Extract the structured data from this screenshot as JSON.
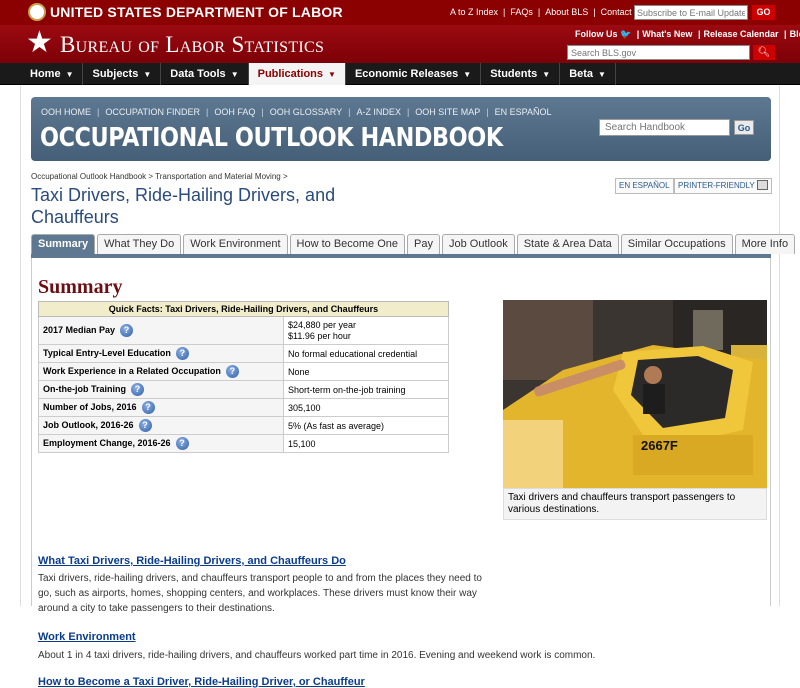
{
  "header": {
    "dol_title": "UNITED STATES DEPARTMENT OF LABOR",
    "top_links": [
      "A to Z Index",
      "FAQs",
      "About BLS",
      "Contact Us"
    ],
    "email_placeholder": "Subscribe to E-mail Updates",
    "go_label": "GO",
    "bls_title": "Bureau of Labor Statistics",
    "follow_links": [
      "Follow Us",
      "What's New",
      "Release Calendar",
      "Blog"
    ],
    "search_placeholder": "Search BLS.gov"
  },
  "nav": {
    "items": [
      "Home",
      "Subjects",
      "Data Tools",
      "Publications",
      "Economic Releases",
      "Students",
      "Beta"
    ]
  },
  "ooh": {
    "links": [
      "OOH HOME",
      "OCCUPATION FINDER",
      "OOH FAQ",
      "OOH GLOSSARY",
      "A-Z INDEX",
      "OOH SITE MAP",
      "EN ESPAÑOL"
    ],
    "title": "OCCUPATIONAL OUTLOOK HANDBOOK",
    "search_placeholder": "Search Handbook",
    "go_label": "Go"
  },
  "breadcrumb": {
    "items": [
      "Occupational Outlook Handbook",
      "Transportation and Material Moving"
    ],
    "sep": ">"
  },
  "page": {
    "title": "Taxi Drivers, Ride-Hailing Drivers, and Chauffeurs",
    "espanol_label": "EN ESPAÑOL",
    "printer_label": "PRINTER-FRIENDLY"
  },
  "tabs": [
    "Summary",
    "What They Do",
    "Work Environment",
    "How to Become One",
    "Pay",
    "Job Outlook",
    "State & Area Data",
    "Similar Occupations",
    "More Info"
  ],
  "summary": {
    "heading": "Summary",
    "quick_facts_title": "Quick Facts: Taxi Drivers, Ride-Hailing Drivers, and Chauffeurs",
    "rows": [
      {
        "label": "2017 Median Pay",
        "value": "$24,880 per year",
        "value2": "$11.96 per hour"
      },
      {
        "label": "Typical Entry-Level Education",
        "value": "No formal educational credential"
      },
      {
        "label": "Work Experience in a Related Occupation",
        "value": "None"
      },
      {
        "label": "On-the-job Training",
        "value": "Short-term on-the-job training"
      },
      {
        "label": "Number of Jobs, 2016",
        "value": "305,100"
      },
      {
        "label": "Job Outlook, 2016-26",
        "value": "5% (As fast as average)"
      },
      {
        "label": "Employment Change, 2016-26",
        "value": "15,100"
      }
    ],
    "help_glyph": "?",
    "photo_caption": "Taxi drivers and chauffeurs transport passengers to various destinations.",
    "cab_number": "2667F",
    "sections": [
      {
        "link": "What Taxi Drivers, Ride-Hailing Drivers, and Chauffeurs Do",
        "text": "Taxi drivers, ride-hailing drivers, and chauffeurs transport people to and from the places they need to go, such as airports, homes, shopping centers, and workplaces. These drivers must know their way around a city to take passengers to their destinations."
      },
      {
        "link": "Work Environment",
        "text": "About 1 in 4 taxi drivers, ride-hailing drivers, and chauffeurs worked part time in 2016. Evening and weekend work is common."
      },
      {
        "link": "How to Become a Taxi Driver, Ride-Hailing Driver, or Chauffeur",
        "text": ""
      }
    ]
  },
  "colors": {
    "header_red": "#8b0000",
    "nav_black": "#1a1a1a",
    "ooh_blue": "#5e7891",
    "title_blue": "#2a4b7c",
    "summary_maroon": "#6b0f14",
    "link_blue": "#0b3c8c",
    "quickfacts_header": "#f1ecc9"
  }
}
